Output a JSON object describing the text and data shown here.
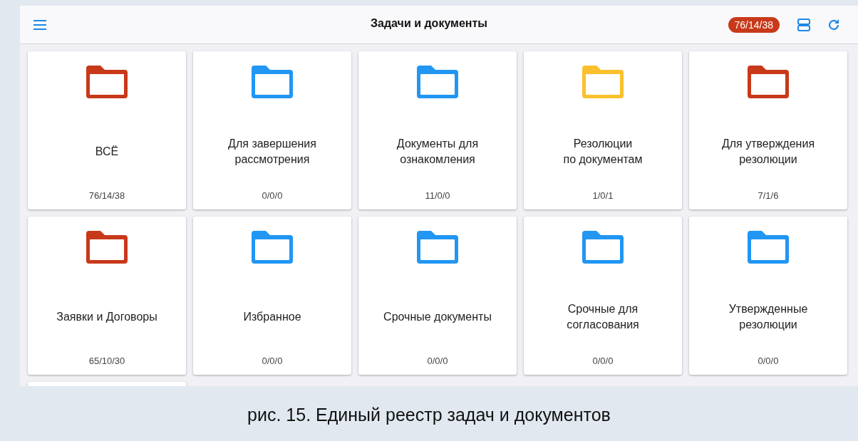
{
  "header": {
    "title": "Задачи и документы",
    "badge": "76/14/38"
  },
  "folders": [
    {
      "title": "ВСЁ",
      "count": "76/14/38",
      "color": "#c8391a"
    },
    {
      "title": "Для завершения\nрассмотрения",
      "count": "0/0/0",
      "color": "#2196f3"
    },
    {
      "title": "Документы для\nознакомления",
      "count": "11/0/0",
      "color": "#2196f3"
    },
    {
      "title": "Резолюции\nпо документам",
      "count": "1/0/1",
      "color": "#fbc02d"
    },
    {
      "title": "Для утверждения\nрезолюции",
      "count": "7/1/6",
      "color": "#c8391a"
    },
    {
      "title": "Заявки и Договоры",
      "count": "65/10/30",
      "color": "#c8391a"
    },
    {
      "title": "Избранное",
      "count": "0/0/0",
      "color": "#2196f3"
    },
    {
      "title": "Срочные документы",
      "count": "0/0/0",
      "color": "#2196f3"
    },
    {
      "title": "Срочные для\nсогласования",
      "count": "0/0/0",
      "color": "#2196f3"
    },
    {
      "title": "Утвержденные\nрезолюции",
      "count": "0/0/0",
      "color": "#2196f3"
    }
  ],
  "caption": "рис. 15. Единый реестр задач и документов"
}
